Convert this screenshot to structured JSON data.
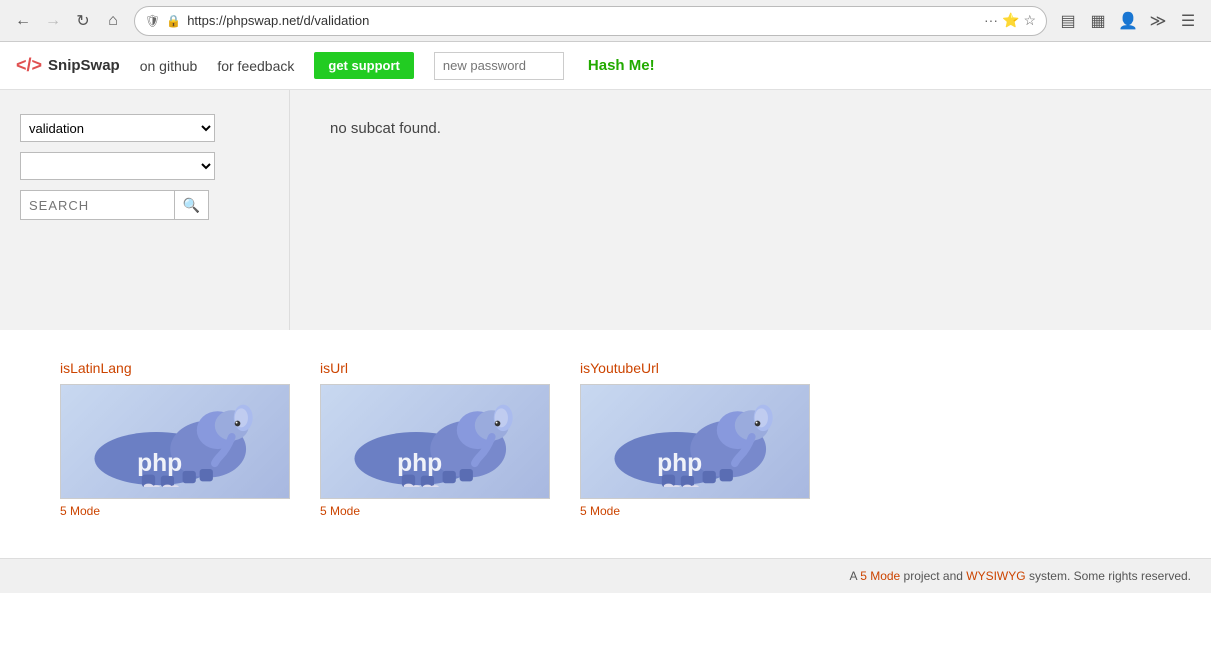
{
  "browser": {
    "url": "https://phpswap.net/d/validation",
    "back_disabled": false,
    "forward_disabled": true
  },
  "header": {
    "logo_text": "SnipSwap",
    "logo_icon": "</> ",
    "nav": [
      {
        "label": "on github",
        "href": "#"
      },
      {
        "label": "for feedback",
        "href": "#"
      }
    ],
    "get_support_label": "get support",
    "password_placeholder": "new password",
    "hash_me_label": "Hash Me!"
  },
  "sidebar": {
    "category_value": "validation",
    "category_options": [
      "validation"
    ],
    "subcat_options": [],
    "search_placeholder": "SEARCH"
  },
  "subcat": {
    "no_subcat_message": "no subcat found."
  },
  "snippets": [
    {
      "title": "isLatinLang",
      "meta": "5 Mode"
    },
    {
      "title": "isUrl",
      "meta": "5 Mode"
    },
    {
      "title": "isYoutubeUrl",
      "meta": "5 Mode"
    }
  ],
  "footer": {
    "text_prefix": "A ",
    "mode_label": "5 Mode",
    "text_middle": " project and ",
    "wysiwyg_label": "WYSIWYG",
    "text_suffix": " system. Some rights reserved."
  }
}
